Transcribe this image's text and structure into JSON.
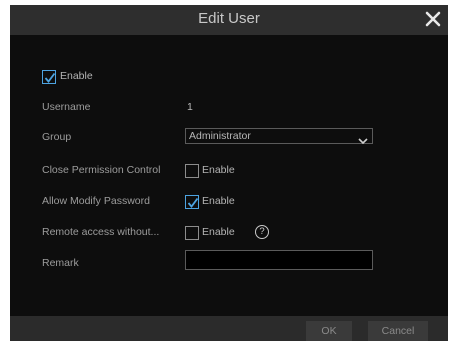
{
  "dialog": {
    "title": "Edit User",
    "close_icon": "close-icon"
  },
  "form": {
    "enable": {
      "checked": true,
      "label": "Enable"
    },
    "username": {
      "label": "Username",
      "value": "1"
    },
    "group": {
      "label": "Group",
      "selected": "Administrator"
    },
    "close_permission_control": {
      "label": "Close Permission Control",
      "checked": false,
      "option_label": "Enable"
    },
    "allow_modify_password": {
      "label": "Allow Modify Password",
      "checked": true,
      "option_label": "Enable"
    },
    "remote_access": {
      "label": "Remote access without...",
      "checked": false,
      "option_label": "Enable",
      "help_icon": "help-icon",
      "help_text": "?"
    },
    "remark": {
      "label": "Remark",
      "value": ""
    }
  },
  "footer": {
    "ok_label": "OK",
    "cancel_label": "Cancel"
  },
  "colors": {
    "checkmark": "#4da3e0",
    "dialog_bg": "#0d0d0d",
    "titlebar_bg": "#2e2e2e"
  }
}
